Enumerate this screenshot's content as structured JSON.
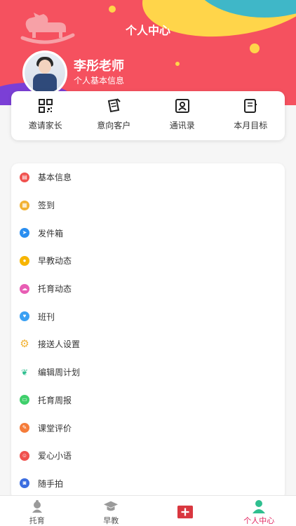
{
  "header": {
    "title": "个人中心",
    "user_name": "李彤老师",
    "subtitle": "个人基本信息",
    "colors": {
      "background": "#f5515f",
      "yellow": "#ffd54a",
      "teal": "#3fb7c8",
      "purple": "#7b3fd6"
    }
  },
  "quick_actions": [
    {
      "label": "邀请家长",
      "icon": "qr-code-icon"
    },
    {
      "label": "意向客户",
      "icon": "clipboard-pen-icon"
    },
    {
      "label": "通讯录",
      "icon": "contacts-icon"
    },
    {
      "label": "本月目标",
      "icon": "notebook-icon"
    }
  ],
  "menu": {
    "items": [
      {
        "label": "基本信息",
        "icon": "info-card-icon",
        "color": "#f0524f"
      },
      {
        "label": "签到",
        "icon": "calendar-icon",
        "color": "#f2b233"
      },
      {
        "label": "发件箱",
        "icon": "send-icon",
        "color": "#2a8ef0"
      },
      {
        "label": "早教动态",
        "icon": "chat-bubble-icon",
        "color": "#f7b500"
      },
      {
        "label": "托育动态",
        "icon": "cloud-icon",
        "color": "#e85db4"
      },
      {
        "label": "班刊",
        "icon": "heart-bubble-icon",
        "color": "#3aa0f3"
      },
      {
        "label": "接送人设置",
        "icon": "gear-icon",
        "color": "#f2b233"
      },
      {
        "label": "编辑周计划",
        "icon": "leaf-icon",
        "color": "#2fbf8f"
      },
      {
        "label": "托育周报",
        "icon": "report-icon",
        "color": "#3fcf6b"
      },
      {
        "label": "课堂评价",
        "icon": "pencil-icon",
        "color": "#f57c3a"
      },
      {
        "label": "爱心小语",
        "icon": "smile-icon",
        "color": "#f0524f"
      },
      {
        "label": "随手拍",
        "icon": "camera-icon",
        "color": "#3b6de0"
      }
    ]
  },
  "bottom_nav": {
    "items": [
      {
        "label": "托育",
        "icon": "baby-icon",
        "active": false
      },
      {
        "label": "早教",
        "icon": "graduation-cap-icon",
        "active": false
      },
      {
        "label": "",
        "icon": "plus-box-icon",
        "active": false
      },
      {
        "label": "个人中心",
        "icon": "person-icon",
        "active": true
      }
    ],
    "active_color": "#e0245e"
  }
}
